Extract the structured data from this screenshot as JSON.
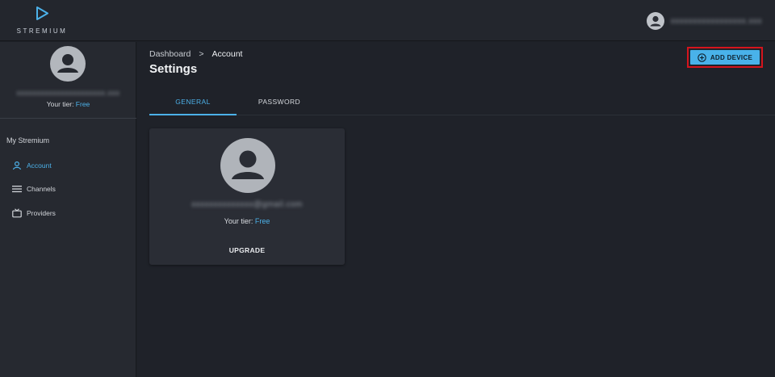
{
  "app": {
    "logo_text": "STREMIUM",
    "accent_color": "#4cb1e9",
    "highlight_color": "#d4141c"
  },
  "topbar": {
    "user_email": "xxxxxxxxxxxxxxxxx.xxx"
  },
  "sidebar": {
    "email": "xxxxxxxxxxxxxxxxxxxxxx.xxx",
    "tier_label": "Your tier: ",
    "tier_value": "Free",
    "section_title": "My Stremium",
    "items": [
      {
        "label": "Account",
        "icon": "user-icon",
        "active": true
      },
      {
        "label": "Channels",
        "icon": "list-icon",
        "active": false
      },
      {
        "label": "Providers",
        "icon": "tv-icon",
        "active": false
      }
    ]
  },
  "header": {
    "breadcrumb": [
      "Dashboard",
      "Account"
    ],
    "breadcrumb_separator": ">",
    "title": "Settings",
    "add_device_label": "ADD DEVICE"
  },
  "tabs": [
    {
      "label": "GENERAL",
      "active": true
    },
    {
      "label": "PASSWORD",
      "active": false
    }
  ],
  "card": {
    "email": "xxxxxxxxxxxxxx@gmail.com",
    "tier_label": "Your tier: ",
    "tier_value": "Free",
    "upgrade_label": "UPGRADE"
  }
}
